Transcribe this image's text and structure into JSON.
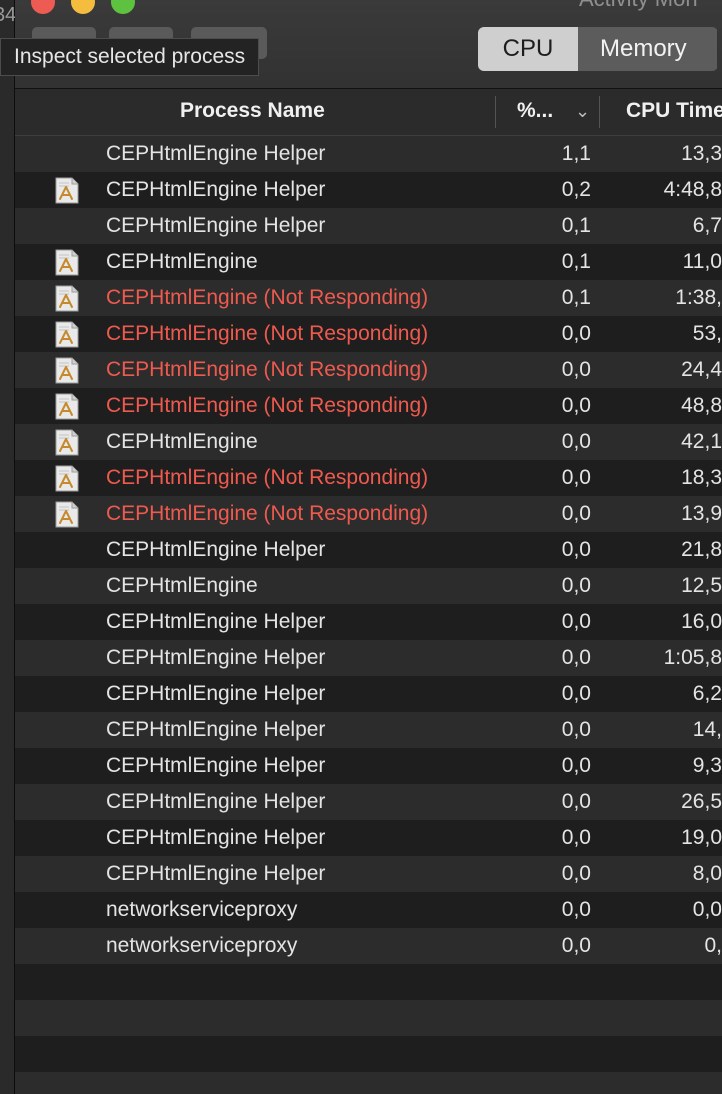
{
  "window": {
    "title": "Activity Mon",
    "left_strip_text": "34"
  },
  "toolbar": {
    "tooltip": "Inspect selected process",
    "tabs": [
      {
        "label": "CPU",
        "active": true
      },
      {
        "label": "Memory",
        "active": false
      }
    ]
  },
  "table": {
    "columns": {
      "name": "Process Name",
      "pct": "%...",
      "time": "CPU Time"
    },
    "rows": [
      {
        "name": "CEPHtmlEngine Helper",
        "pct": "1,1",
        "time": "13,3",
        "icon": false,
        "alert": false
      },
      {
        "name": "CEPHtmlEngine Helper",
        "pct": "0,2",
        "time": "4:48,8",
        "icon": true,
        "alert": false
      },
      {
        "name": "CEPHtmlEngine Helper",
        "pct": "0,1",
        "time": "6,7",
        "icon": false,
        "alert": false
      },
      {
        "name": "CEPHtmlEngine",
        "pct": "0,1",
        "time": "11,0",
        "icon": true,
        "alert": false
      },
      {
        "name": "CEPHtmlEngine (Not Responding)",
        "pct": "0,1",
        "time": "1:38,",
        "icon": true,
        "alert": true
      },
      {
        "name": "CEPHtmlEngine (Not Responding)",
        "pct": "0,0",
        "time": "53,",
        "icon": true,
        "alert": true
      },
      {
        "name": "CEPHtmlEngine (Not Responding)",
        "pct": "0,0",
        "time": "24,4",
        "icon": true,
        "alert": true
      },
      {
        "name": "CEPHtmlEngine (Not Responding)",
        "pct": "0,0",
        "time": "48,8",
        "icon": true,
        "alert": true
      },
      {
        "name": "CEPHtmlEngine",
        "pct": "0,0",
        "time": "42,1",
        "icon": true,
        "alert": false
      },
      {
        "name": "CEPHtmlEngine (Not Responding)",
        "pct": "0,0",
        "time": "18,3",
        "icon": true,
        "alert": true
      },
      {
        "name": "CEPHtmlEngine (Not Responding)",
        "pct": "0,0",
        "time": "13,9",
        "icon": true,
        "alert": true
      },
      {
        "name": "CEPHtmlEngine Helper",
        "pct": "0,0",
        "time": "21,8",
        "icon": false,
        "alert": false
      },
      {
        "name": "CEPHtmlEngine",
        "pct": "0,0",
        "time": "12,5",
        "icon": false,
        "alert": false
      },
      {
        "name": "CEPHtmlEngine Helper",
        "pct": "0,0",
        "time": "16,0",
        "icon": false,
        "alert": false
      },
      {
        "name": "CEPHtmlEngine Helper",
        "pct": "0,0",
        "time": "1:05,8",
        "icon": false,
        "alert": false
      },
      {
        "name": "CEPHtmlEngine Helper",
        "pct": "0,0",
        "time": "6,2",
        "icon": false,
        "alert": false
      },
      {
        "name": "CEPHtmlEngine Helper",
        "pct": "0,0",
        "time": "14,",
        "icon": false,
        "alert": false
      },
      {
        "name": "CEPHtmlEngine Helper",
        "pct": "0,0",
        "time": "9,3",
        "icon": false,
        "alert": false
      },
      {
        "name": "CEPHtmlEngine Helper",
        "pct": "0,0",
        "time": "26,5",
        "icon": false,
        "alert": false
      },
      {
        "name": "CEPHtmlEngine Helper",
        "pct": "0,0",
        "time": "19,0",
        "icon": false,
        "alert": false
      },
      {
        "name": "CEPHtmlEngine Helper",
        "pct": "0,0",
        "time": "8,0",
        "icon": false,
        "alert": false
      },
      {
        "name": "networkserviceproxy",
        "pct": "0,0",
        "time": "0,0",
        "icon": false,
        "alert": false
      },
      {
        "name": "networkserviceproxy",
        "pct": "0,0",
        "time": "0,",
        "icon": false,
        "alert": false
      }
    ],
    "empty_rows": 4
  },
  "colors": {
    "alert_text": "#ef5a4f",
    "normal_text": "#e4e4e4",
    "row_alt": "#2c2c2c",
    "row_base": "#1e1e1e"
  }
}
